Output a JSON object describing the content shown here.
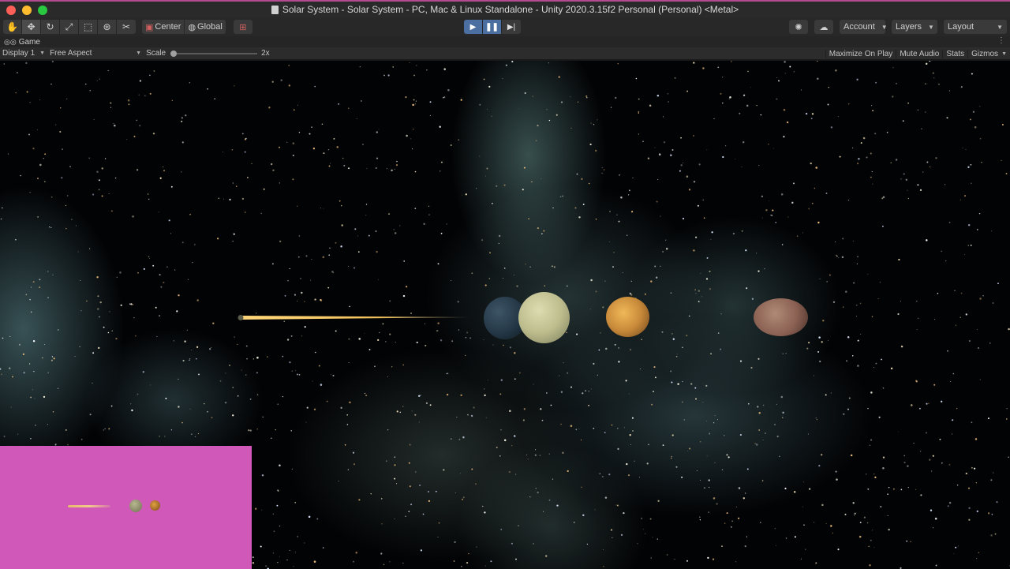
{
  "window": {
    "title": "Solar System - Solar System - PC, Mac & Linux Standalone - Unity 2020.3.15f2 Personal (Personal) <Metal>"
  },
  "toolbar": {
    "tools": [
      "hand-tool",
      "move-tool",
      "rotate-tool",
      "scale-tool",
      "rect-tool",
      "transform-tool",
      "custom-tool"
    ],
    "pivot_label": "Center",
    "space_label": "Global",
    "account_label": "Account",
    "layers_label": "Layers",
    "layout_label": "Layout"
  },
  "tab": {
    "label": "Game"
  },
  "gamebar": {
    "display": "Display 1",
    "aspect": "Free Aspect",
    "scale_label": "Scale",
    "scale_value": "2x",
    "maximize": "Maximize On Play",
    "mute": "Mute Audio",
    "stats": "Stats",
    "gizmos": "Gizmos"
  },
  "colors": {
    "play_active": "#4a6fa0",
    "minimap_bg": "#cf58b8",
    "comet": "#f2c15c"
  },
  "icons": {
    "hand": "hand-icon",
    "move": "move-icon",
    "play": "play-icon",
    "pause": "pause-icon",
    "step": "step-icon",
    "cloud": "cloud-icon",
    "collab": "collab-icon"
  }
}
